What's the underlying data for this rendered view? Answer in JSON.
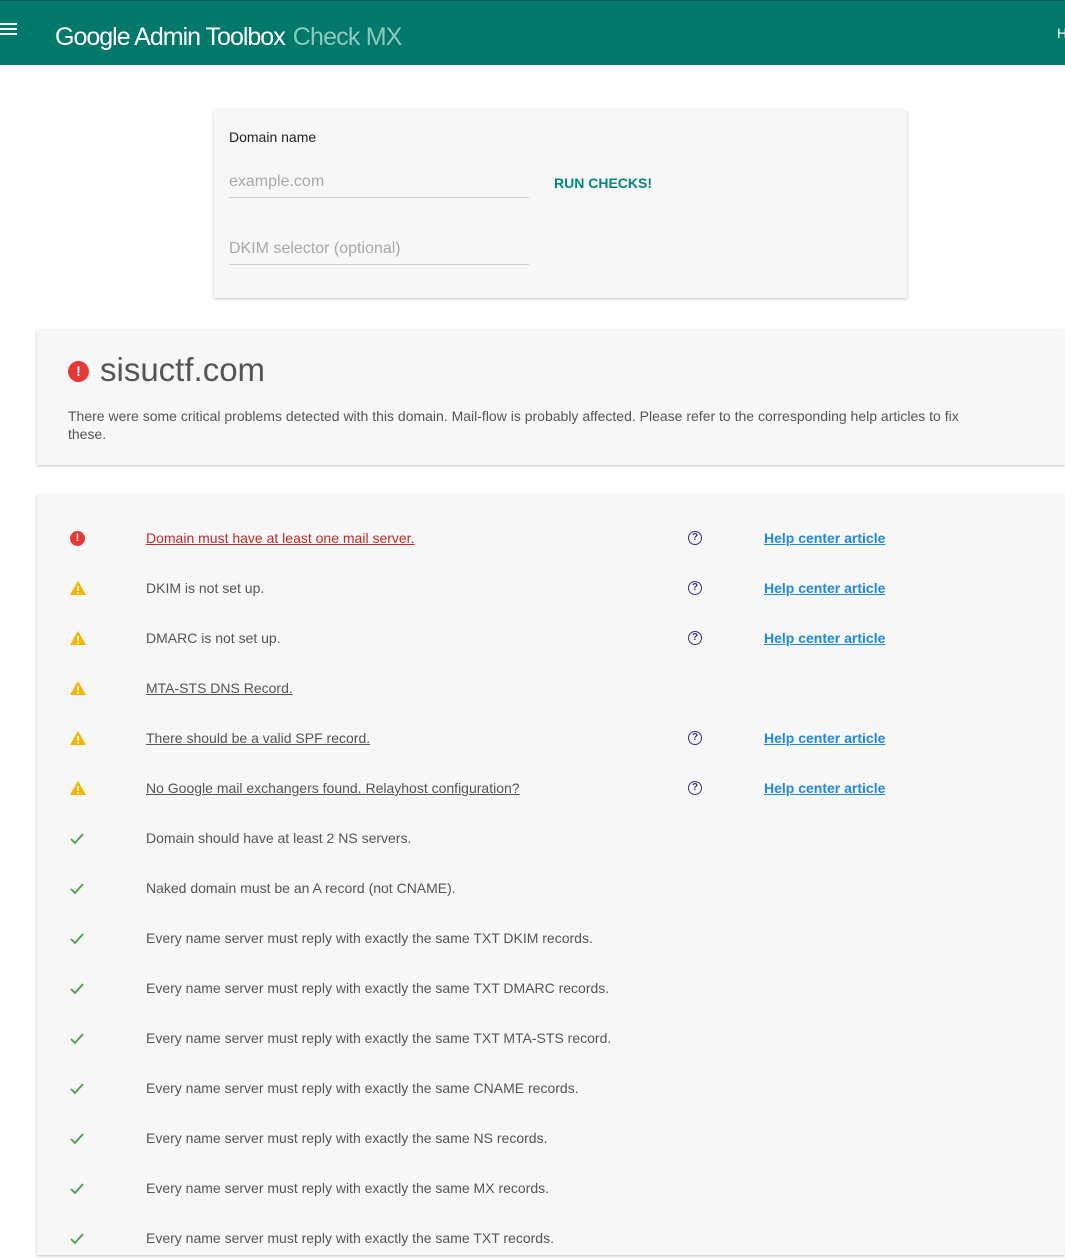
{
  "header": {
    "title": "Google Admin Toolbox",
    "subtitle": "Check MX",
    "corner_text": "H"
  },
  "form": {
    "label": "Domain name",
    "domain_placeholder": "example.com",
    "dkim_placeholder": "DKIM selector (optional)",
    "run_label": "RUN CHECKS!"
  },
  "summary": {
    "status_icon": "error-icon",
    "status_glyph": "!",
    "domain": "sisuctf.com",
    "description": "There were some critical problems detected with this domain. Mail-flow is probably affected. Please refer to the corresponding help articles to fix these."
  },
  "colors": {
    "header_bg": "#00796b",
    "accent": "#00897b",
    "error": "#e53935",
    "warning": "#f4b400",
    "ok": "#43a047",
    "link": "#1e88e5"
  },
  "help_label": "Help center article",
  "checks": [
    {
      "status": "error",
      "text": "Domain must have at least one mail server.",
      "linked": true,
      "has_help": true
    },
    {
      "status": "warning",
      "text": "DKIM is not set up.",
      "linked": false,
      "has_help": true
    },
    {
      "status": "warning",
      "text": "DMARC is not set up.",
      "linked": false,
      "has_help": true
    },
    {
      "status": "warning",
      "text": "MTA-STS DNS Record.",
      "linked": true,
      "has_help": false
    },
    {
      "status": "warning",
      "text": "There should be a valid SPF record.",
      "linked": true,
      "has_help": true
    },
    {
      "status": "warning",
      "text": "No Google mail exchangers found. Relayhost configuration?",
      "linked": true,
      "has_help": true
    },
    {
      "status": "ok",
      "text": "Domain should have at least 2 NS servers.",
      "linked": false,
      "has_help": false
    },
    {
      "status": "ok",
      "text": "Naked domain must be an A record (not CNAME).",
      "linked": false,
      "has_help": false
    },
    {
      "status": "ok",
      "text": "Every name server must reply with exactly the same TXT DKIM records.",
      "linked": false,
      "has_help": false
    },
    {
      "status": "ok",
      "text": "Every name server must reply with exactly the same TXT DMARC records.",
      "linked": false,
      "has_help": false
    },
    {
      "status": "ok",
      "text": "Every name server must reply with exactly the same TXT MTA-STS record.",
      "linked": false,
      "has_help": false
    },
    {
      "status": "ok",
      "text": "Every name server must reply with exactly the same CNAME records.",
      "linked": false,
      "has_help": false
    },
    {
      "status": "ok",
      "text": "Every name server must reply with exactly the same NS records.",
      "linked": false,
      "has_help": false
    },
    {
      "status": "ok",
      "text": "Every name server must reply with exactly the same MX records.",
      "linked": false,
      "has_help": false
    },
    {
      "status": "ok",
      "text": "Every name server must reply with exactly the same TXT records.",
      "linked": false,
      "has_help": false
    }
  ]
}
